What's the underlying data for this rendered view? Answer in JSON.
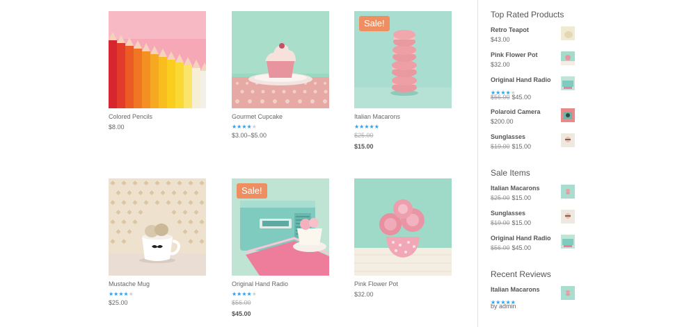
{
  "products": [
    {
      "name": "Colored Pencils",
      "price": "$8.00",
      "rating": 0,
      "sale": false
    },
    {
      "name": "Gourmet Cupcake",
      "price": "$3.00–$5.00",
      "rating": 0.8,
      "sale": false
    },
    {
      "name": "Italian Macarons",
      "old_price": "$25.00",
      "new_price": "$15.00",
      "rating": 1.0,
      "sale": true,
      "sale_label": "Sale!"
    },
    {
      "name": "Mustache Mug",
      "price": "$25.00",
      "rating": 0.75,
      "sale": false
    },
    {
      "name": "Original Hand Radio",
      "old_price": "$56.00",
      "new_price": "$45.00",
      "rating": 0.8,
      "sale": true,
      "sale_label": "Sale!"
    },
    {
      "name": "Pink Flower Pot",
      "price": "$32.00",
      "rating": 0,
      "sale": false
    }
  ],
  "sidebar": {
    "top_rated": {
      "title": "Top Rated Products",
      "items": [
        {
          "name": "Retro Teapot",
          "price": "$43.00"
        },
        {
          "name": "Pink Flower Pot",
          "price": "$32.00"
        },
        {
          "name": "Original Hand Radio",
          "old_price": "$56.00",
          "price": "$45.00",
          "rating": 0.8
        },
        {
          "name": "Polaroid Camera",
          "price": "$200.00"
        },
        {
          "name": "Sunglasses",
          "old_price": "$19.00",
          "price": "$15.00"
        }
      ]
    },
    "sale_items": {
      "title": "Sale Items",
      "items": [
        {
          "name": "Italian Macarons",
          "old_price": "$25.00",
          "price": "$15.00"
        },
        {
          "name": "Sunglasses",
          "old_price": "$19.00",
          "price": "$15.00"
        },
        {
          "name": "Original Hand Radio",
          "old_price": "$56.00",
          "price": "$45.00"
        }
      ]
    },
    "recent_reviews": {
      "title": "Recent Reviews",
      "items": [
        {
          "name": "Italian Macarons",
          "rating": 1.0,
          "by": "by admin"
        }
      ]
    }
  },
  "colors": {
    "accent_star": "#2ea3f2",
    "sale_badge": "#ef8f61"
  }
}
